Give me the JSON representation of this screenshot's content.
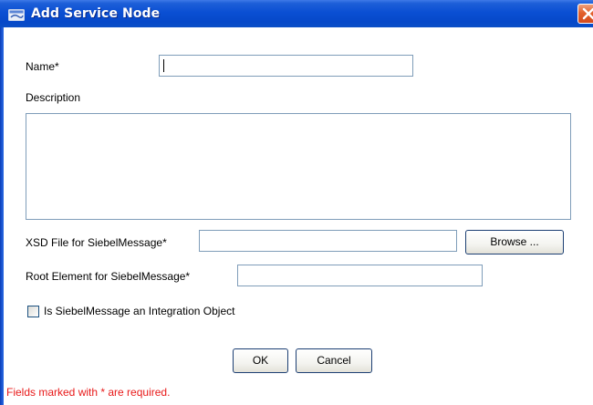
{
  "window": {
    "title": "Add Service Node",
    "title_icon": "app-window-icon",
    "close_icon": "close-icon"
  },
  "form": {
    "name_label": "Name*",
    "name_value": "",
    "description_label": "Description",
    "description_value": "",
    "xsd_label": "XSD File for SiebelMessage*",
    "xsd_value": "",
    "browse_label": "Browse ...",
    "root_label": "Root Element for SiebelMessage*",
    "root_value": "",
    "integration_checkbox_label": "Is SiebelMessage an Integration Object",
    "integration_checked": false
  },
  "buttons": {
    "ok_label": "OK",
    "cancel_label": "Cancel"
  },
  "footer": {
    "required_note": "Fields marked with * are required."
  },
  "colors": {
    "titlebar": "#0a4fd3",
    "required_text": "#e81a1a",
    "close_button": "#e2612d"
  }
}
